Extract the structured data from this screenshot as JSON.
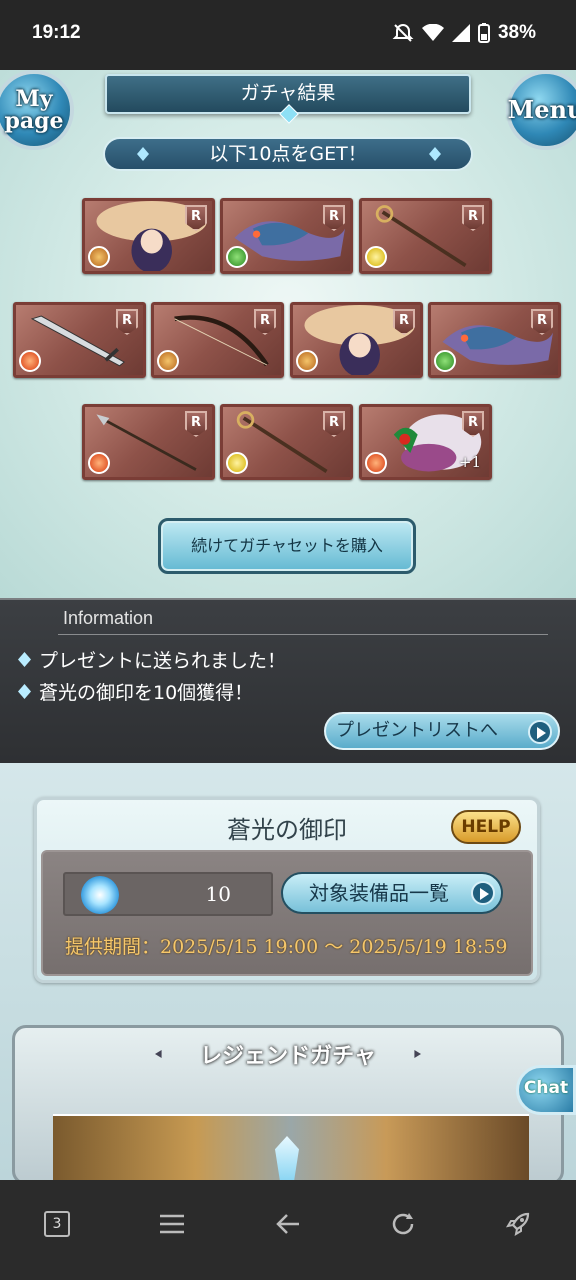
{
  "status_bar": {
    "time": "19:12",
    "battery": "38%"
  },
  "header": {
    "title": "ガチャ結果",
    "mypage_label": "My page",
    "menu_label": "Menu"
  },
  "result_banner": "以下10点をGET！",
  "cards": [
    {
      "rarity": "R",
      "element": "earth",
      "art": "character-icon",
      "plus": ""
    },
    {
      "rarity": "R",
      "element": "wind",
      "art": "dragon-icon",
      "plus": ""
    },
    {
      "rarity": "R",
      "element": "light",
      "art": "staff-icon",
      "plus": ""
    },
    {
      "rarity": "R",
      "element": "fire",
      "art": "sword-icon",
      "plus": ""
    },
    {
      "rarity": "R",
      "element": "earth",
      "art": "bow-icon",
      "plus": ""
    },
    {
      "rarity": "R",
      "element": "earth",
      "art": "character-icon",
      "plus": ""
    },
    {
      "rarity": "R",
      "element": "wind",
      "art": "dragon-icon",
      "plus": ""
    },
    {
      "rarity": "R",
      "element": "fire",
      "art": "spear-icon",
      "plus": ""
    },
    {
      "rarity": "R",
      "element": "light",
      "art": "staff-icon",
      "plus": ""
    },
    {
      "rarity": "R",
      "element": "fire",
      "art": "beast-icon",
      "plus": "+1"
    }
  ],
  "buy_button": "続けてガチャセットを購入",
  "information": {
    "title": "Information",
    "items": [
      "プレゼントに送られました！",
      "蒼光の御印を10個獲得！"
    ],
    "present_button": "プレゼントリストへ"
  },
  "seal": {
    "title": "蒼光の御印",
    "help": "HELP",
    "count": "10",
    "equipment_button": "対象装備品一覧",
    "period": "提供期間：2025/5/15 19:00 〜 2025/5/19 18:59"
  },
  "legend": {
    "title": "レジェンドガチャ"
  },
  "chat_label": "Chat",
  "nav": {
    "tabs_count": "3"
  },
  "colors": {
    "accent": "#63b9d2",
    "panel_dark": "#3c3f43",
    "period_text": "#f6c76a",
    "card_frame": "#7a3d36"
  }
}
